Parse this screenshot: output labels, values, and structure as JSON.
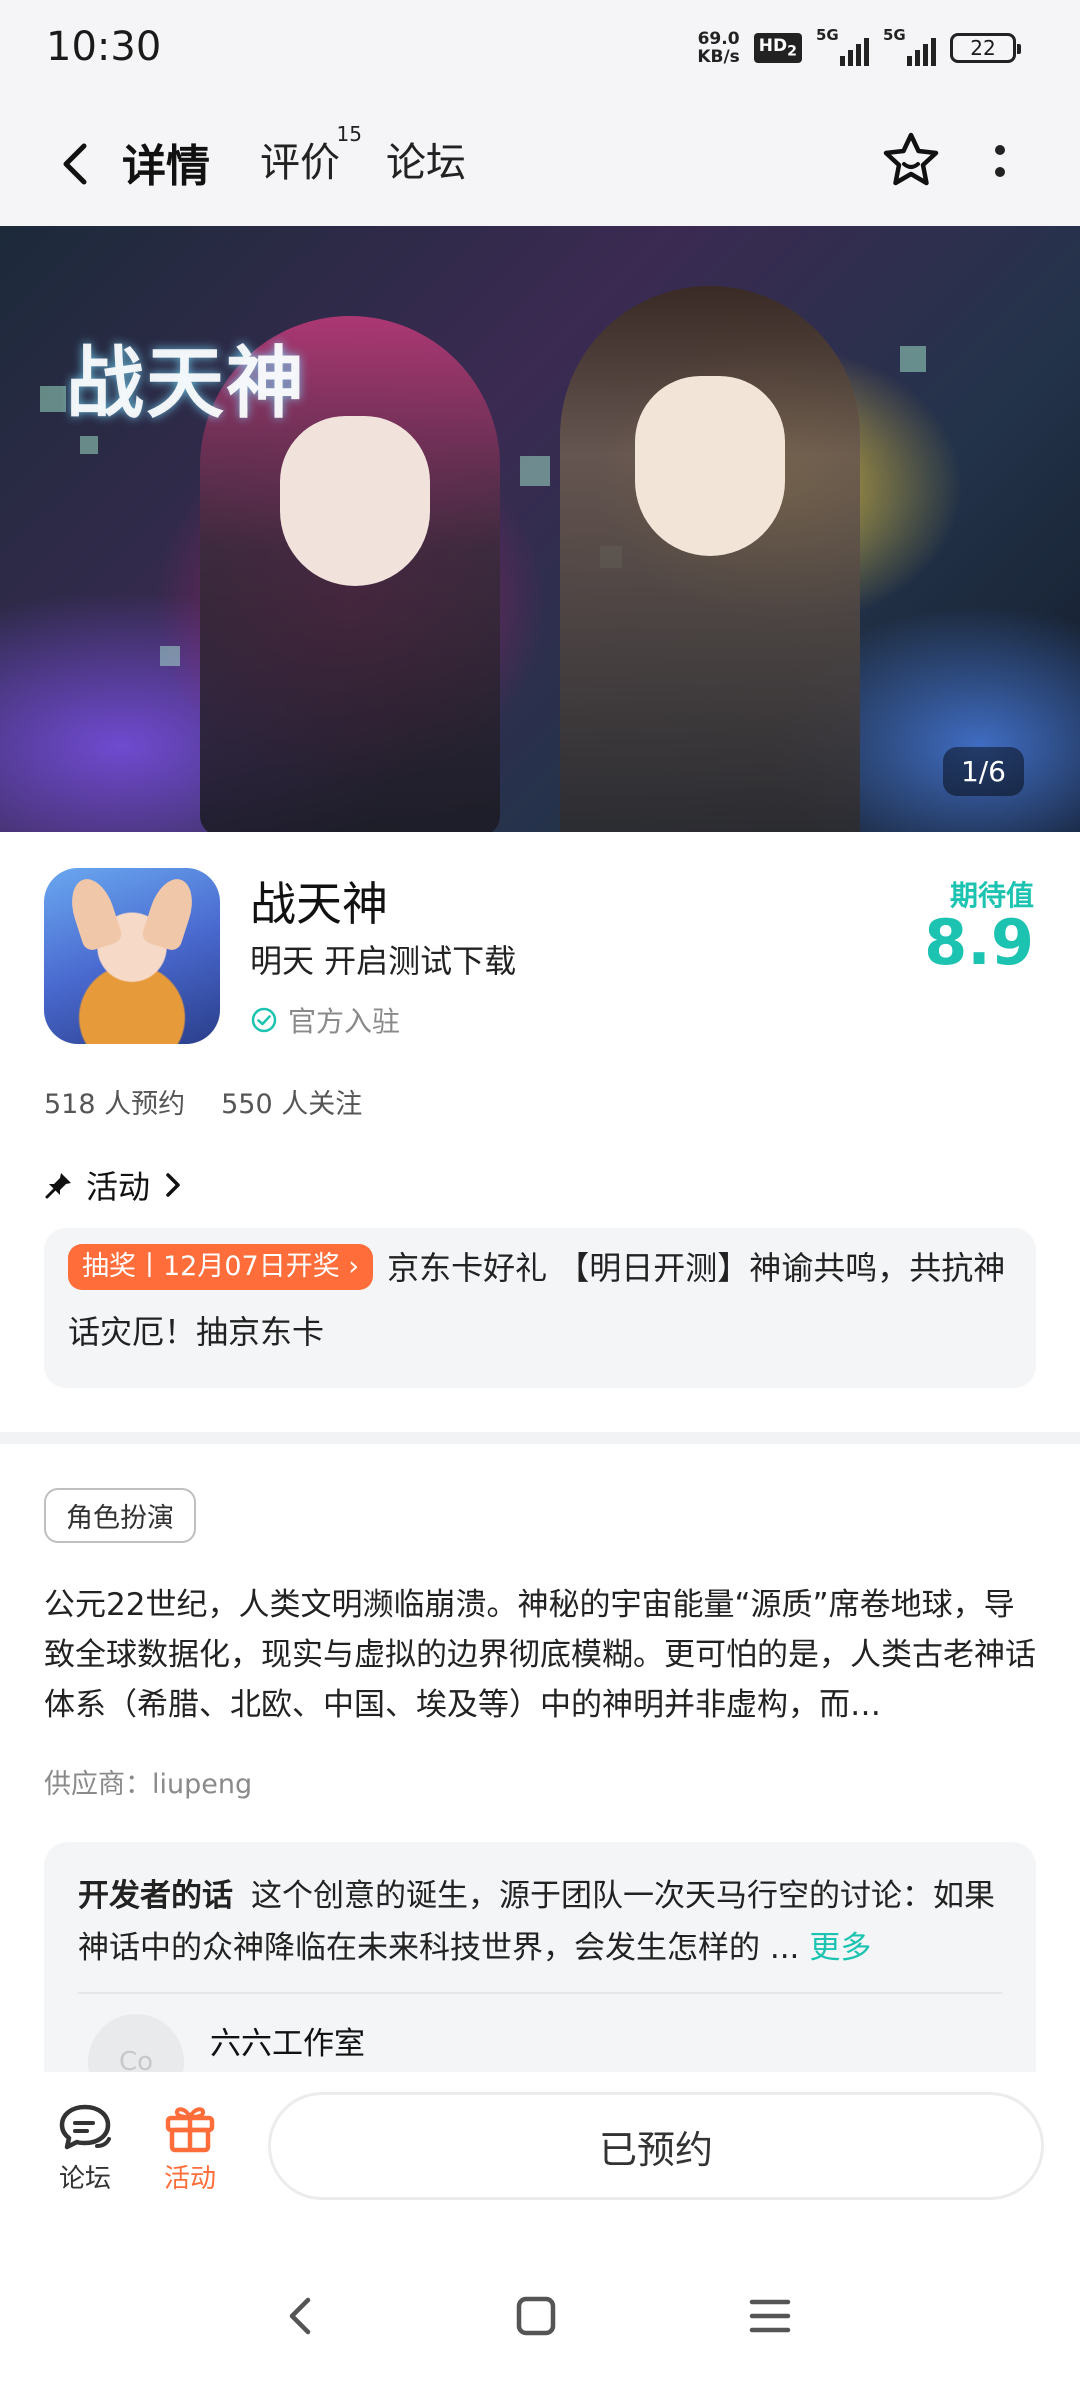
{
  "status_bar": {
    "time": "10:30",
    "speed_value": "69.0",
    "speed_unit": "KB/s",
    "hd": "HD",
    "hd_sub": "2",
    "network1": "5G",
    "network2": "5G",
    "battery": "22"
  },
  "nav": {
    "tabs": [
      {
        "label": "详情",
        "active": true
      },
      {
        "label": "评价",
        "badge": "15"
      },
      {
        "label": "论坛"
      }
    ]
  },
  "banner": {
    "logo_text": "战天神",
    "page_indicator": "1/6"
  },
  "game": {
    "title": "战天神",
    "release": "明天 开启测试下载",
    "official": "官方入驻",
    "expectation_label": "期待值",
    "expectation_score": "8.9",
    "reservations": "518 人预约",
    "followers": "550 人关注"
  },
  "activity": {
    "header": "活动",
    "tag": "抽奖丨12月07日开奖",
    "text": "京东卡好礼 【明日开测】神谕共鸣，共抗神话灾厄！抽京东卡"
  },
  "description": {
    "genre": "角色扮演",
    "text": "公元22世纪，人类文明濒临崩溃。神秘的宇宙能量“源质”席卷地球，导致全球数据化，现实与虚拟的边界彻底模糊。更可怕的是，人类古老神话体系（希腊、北欧、中国、埃及等）中的神明并非虚构，而…",
    "supplier": "供应商：liupeng"
  },
  "developer": {
    "label": "开发者的话",
    "text": "这个创意的诞生，源于团队一次天马行空的讨论：如果神话中的众神降临在未来科技世界，会发生怎样的 ...",
    "more": "更多",
    "studio": "六六工作室",
    "avatar_text": "Co"
  },
  "bottom_bar": {
    "forum_label": "论坛",
    "activity_label": "活动",
    "reserve_button": "已预约"
  },
  "colors": {
    "accent": "#1cc3b1",
    "orange": "#ff6d3a",
    "tab_underline": "#1fd0bd"
  }
}
